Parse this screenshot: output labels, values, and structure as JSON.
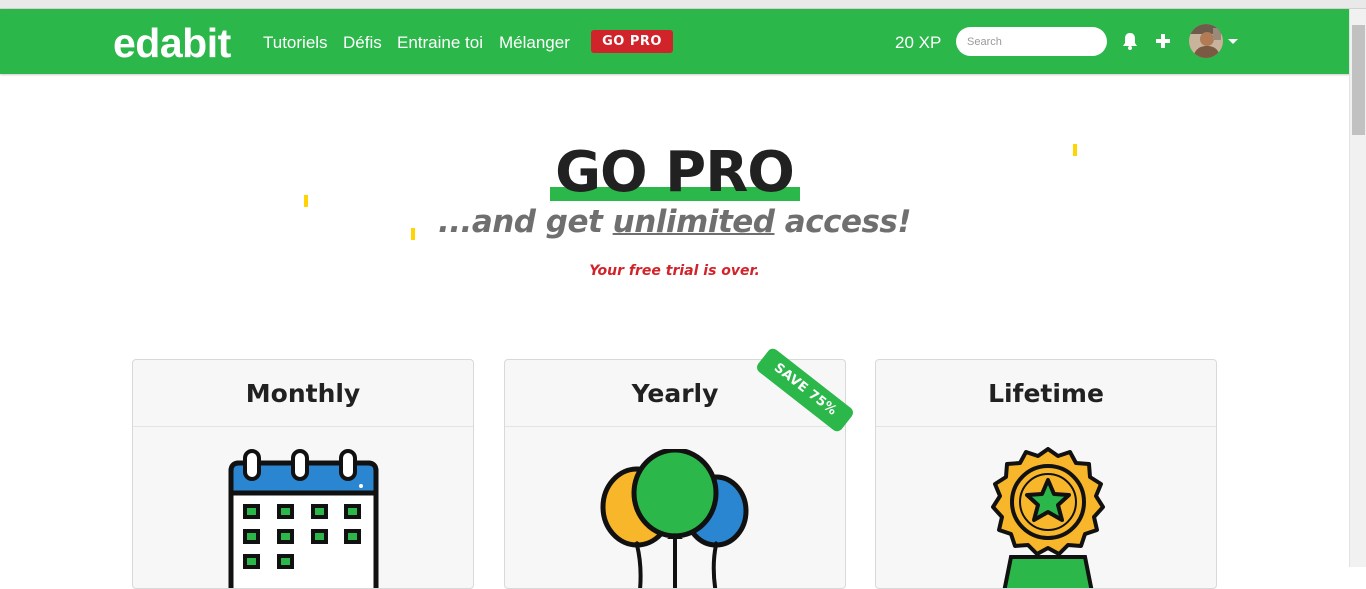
{
  "nav": {
    "logo": "edabit",
    "links": [
      "Tutoriels",
      "Défis",
      "Entraine toi",
      "Mélanger"
    ],
    "pro_label": "GO PRO",
    "xp": "20 XP",
    "search_placeholder": "Search"
  },
  "hero": {
    "title": "GO PRO",
    "subtitle_prefix": "...and get ",
    "subtitle_emphasis": "unlimited",
    "subtitle_suffix": " access!",
    "trial_notice": "Your free trial is over."
  },
  "plans": [
    {
      "name": "Monthly"
    },
    {
      "name": "Yearly",
      "badge": "SAVE 75%"
    },
    {
      "name": "Lifetime"
    }
  ],
  "colors": {
    "brand_green": "#2bb74a",
    "alert_red": "#d1232a",
    "confetti_yellow": "#ffd400"
  },
  "icons": [
    "bell-icon",
    "plus-icon",
    "chevron-down-icon",
    "calendar-icon",
    "balloons-icon",
    "medal-icon"
  ]
}
